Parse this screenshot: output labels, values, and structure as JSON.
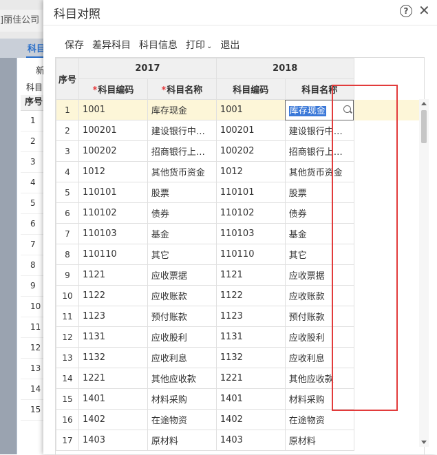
{
  "background": {
    "company_label": "]丽佳公司",
    "tab_label": "科目",
    "new_label": "新",
    "subject_label": "科目",
    "grid_header": "序号",
    "row_numbers": [
      "1",
      "2",
      "3",
      "4",
      "5",
      "6",
      "7",
      "8",
      "9",
      "10",
      "11",
      "12",
      "13",
      "14",
      "15"
    ]
  },
  "dialog": {
    "title": "科目对照",
    "help_icon": "?",
    "close_icon": "✕"
  },
  "toolbar": {
    "save": "保存",
    "diff_subjects": "差异科目",
    "subject_info": "科目信息",
    "print": "打印",
    "print_caret": "⌄",
    "exit": "退出"
  },
  "grid": {
    "header_seq": "序号",
    "year_2017": "2017",
    "year_2018": "2018",
    "required_mark": "*",
    "col_code": "科目编码",
    "col_name": "科目名称",
    "rows": [
      {
        "no": "1",
        "code17": "1001",
        "name17": "库存现金",
        "code18": "1001",
        "name18": "库存现金"
      },
      {
        "no": "2",
        "code17": "100201",
        "name17": "建设银行中…",
        "code18": "100201",
        "name18": "建设银行中…"
      },
      {
        "no": "3",
        "code17": "100202",
        "name17": "招商银行上…",
        "code18": "100202",
        "name18": "招商银行上…"
      },
      {
        "no": "4",
        "code17": "1012",
        "name17": "其他货币资金",
        "code18": "1012",
        "name18": "其他货币资金"
      },
      {
        "no": "5",
        "code17": "110101",
        "name17": "股票",
        "code18": "110101",
        "name18": "股票"
      },
      {
        "no": "6",
        "code17": "110102",
        "name17": "债券",
        "code18": "110102",
        "name18": "债券"
      },
      {
        "no": "7",
        "code17": "110103",
        "name17": "基金",
        "code18": "110103",
        "name18": "基金"
      },
      {
        "no": "8",
        "code17": "110110",
        "name17": "其它",
        "code18": "110110",
        "name18": "其它"
      },
      {
        "no": "9",
        "code17": "1121",
        "name17": "应收票据",
        "code18": "1121",
        "name18": "应收票据"
      },
      {
        "no": "10",
        "code17": "1122",
        "name17": "应收账款",
        "code18": "1122",
        "name18": "应收账款"
      },
      {
        "no": "11",
        "code17": "1123",
        "name17": "预付账款",
        "code18": "1123",
        "name18": "预付账款"
      },
      {
        "no": "12",
        "code17": "1131",
        "name17": "应收股利",
        "code18": "1131",
        "name18": "应收股利"
      },
      {
        "no": "13",
        "code17": "1132",
        "name17": "应收利息",
        "code18": "1132",
        "name18": "应收利息"
      },
      {
        "no": "14",
        "code17": "1221",
        "name17": "其他应收款",
        "code18": "1221",
        "name18": "其他应收款"
      },
      {
        "no": "15",
        "code17": "1401",
        "name17": "材料采购",
        "code18": "1401",
        "name18": "材料采购"
      },
      {
        "no": "16",
        "code17": "1402",
        "name17": "在途物资",
        "code18": "1402",
        "name18": "在途物资"
      },
      {
        "no": "17",
        "code17": "1403",
        "name17": "原材料",
        "code18": "1403",
        "name18": "原材料"
      }
    ]
  },
  "colors": {
    "selected_row": "#fdf6d8",
    "highlight_border": "#e23b3b",
    "text_selection": "#3a78d8",
    "required_mark": "#e4393c"
  }
}
